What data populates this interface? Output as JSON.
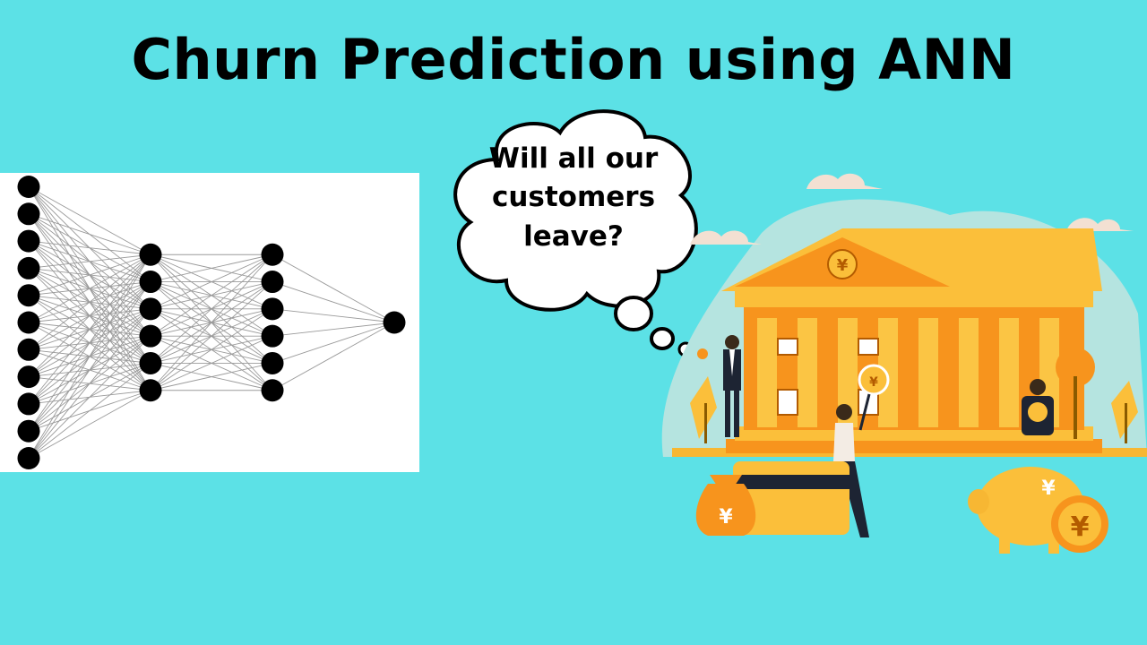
{
  "title": "Churn Prediction using ANN",
  "thought_bubble": {
    "lines": [
      "Will all our",
      "customers",
      "leave?"
    ]
  },
  "colors": {
    "background": "#5ce1e6",
    "title": "#000000",
    "panel": "#ffffff",
    "bank_orange": "#f7941d",
    "bank_yellow": "#fbbf3a"
  },
  "network": {
    "layers": [
      11,
      6,
      6,
      1
    ]
  },
  "illustration": {
    "currency_symbol": "¥",
    "icons": [
      "bank-building-icon",
      "money-bag-icon",
      "piggy-bank-icon",
      "coin-icon",
      "credit-card-icon",
      "businessman-icon",
      "woman-with-magnifier-icon"
    ]
  }
}
